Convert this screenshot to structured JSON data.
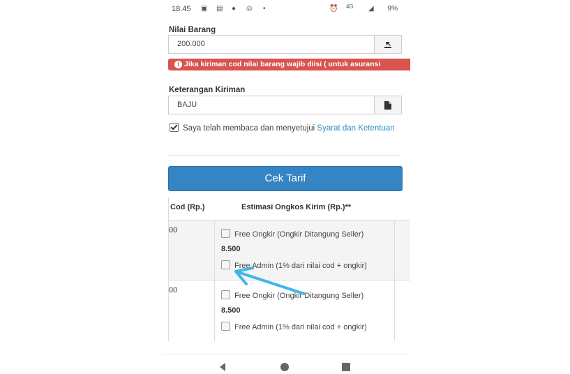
{
  "status_bar": {
    "time": "18.45",
    "network": "4G",
    "battery": "9%"
  },
  "form": {
    "nilai_barang_label": "Nilai Barang",
    "nilai_barang_value": "200.000",
    "alert_text": "Jika kiriman cod nilai barang wajib diisi ( untuk asuransi",
    "keterangan_label": "Keterangan Kiriman",
    "keterangan_value": "BAJU",
    "agree_text": "Saya telah membaca dan menyetujui ",
    "agree_link": "Syarat dan Ketentuan",
    "agree_checked": true,
    "submit_label": "Cek Tarif"
  },
  "table": {
    "headers": [
      "Cod (Rp.)",
      "Estimasi Ongkos Kirim (Rp.)**"
    ],
    "rows": [
      {
        "cod": "00",
        "option1": "Free Ongkir (Ongkir Ditangung Seller)",
        "price": "8.500",
        "option2": "Free Admin (1% dari nilai cod + ongkir)"
      },
      {
        "cod": "00",
        "option1": "Free Ongkir (Ongkir Ditangung Seller)",
        "price": "8.500",
        "option2": "Free Admin (1% dari nilai cod + ongkir)"
      }
    ]
  },
  "colors": {
    "primary_button": "#3585c5",
    "alert": "#d9534f",
    "link": "#2d8ec4",
    "annotation_arrow": "#3fb6e6"
  }
}
